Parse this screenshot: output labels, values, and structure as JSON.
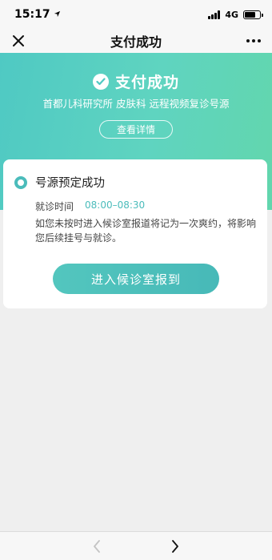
{
  "status_bar": {
    "time": "15:17",
    "network": "4G",
    "battery_level": 0.7
  },
  "nav": {
    "title": "支付成功",
    "close_icon": "close-icon",
    "more_icon": "more-dots-icon"
  },
  "hero": {
    "title": "支付成功",
    "subtitle": "首都儿科研究所 皮肤科 远程视频复诊号源",
    "detail_button": "查看详情",
    "gradient_start": "#4fc9c3",
    "gradient_end": "#62d6ad"
  },
  "card": {
    "title": "号源预定成功",
    "time_label": "就诊时间",
    "time_value": "08:00–08:30",
    "notice": "如您未按时进入候诊室报道将记为一次爽约，将影响您后续挂号与就诊。",
    "checkin_button": "进入候诊室报到",
    "accent_color": "#4bbcbb"
  },
  "bottom_bar": {
    "back_icon": "chevron-left-icon",
    "forward_icon": "chevron-right-icon"
  }
}
